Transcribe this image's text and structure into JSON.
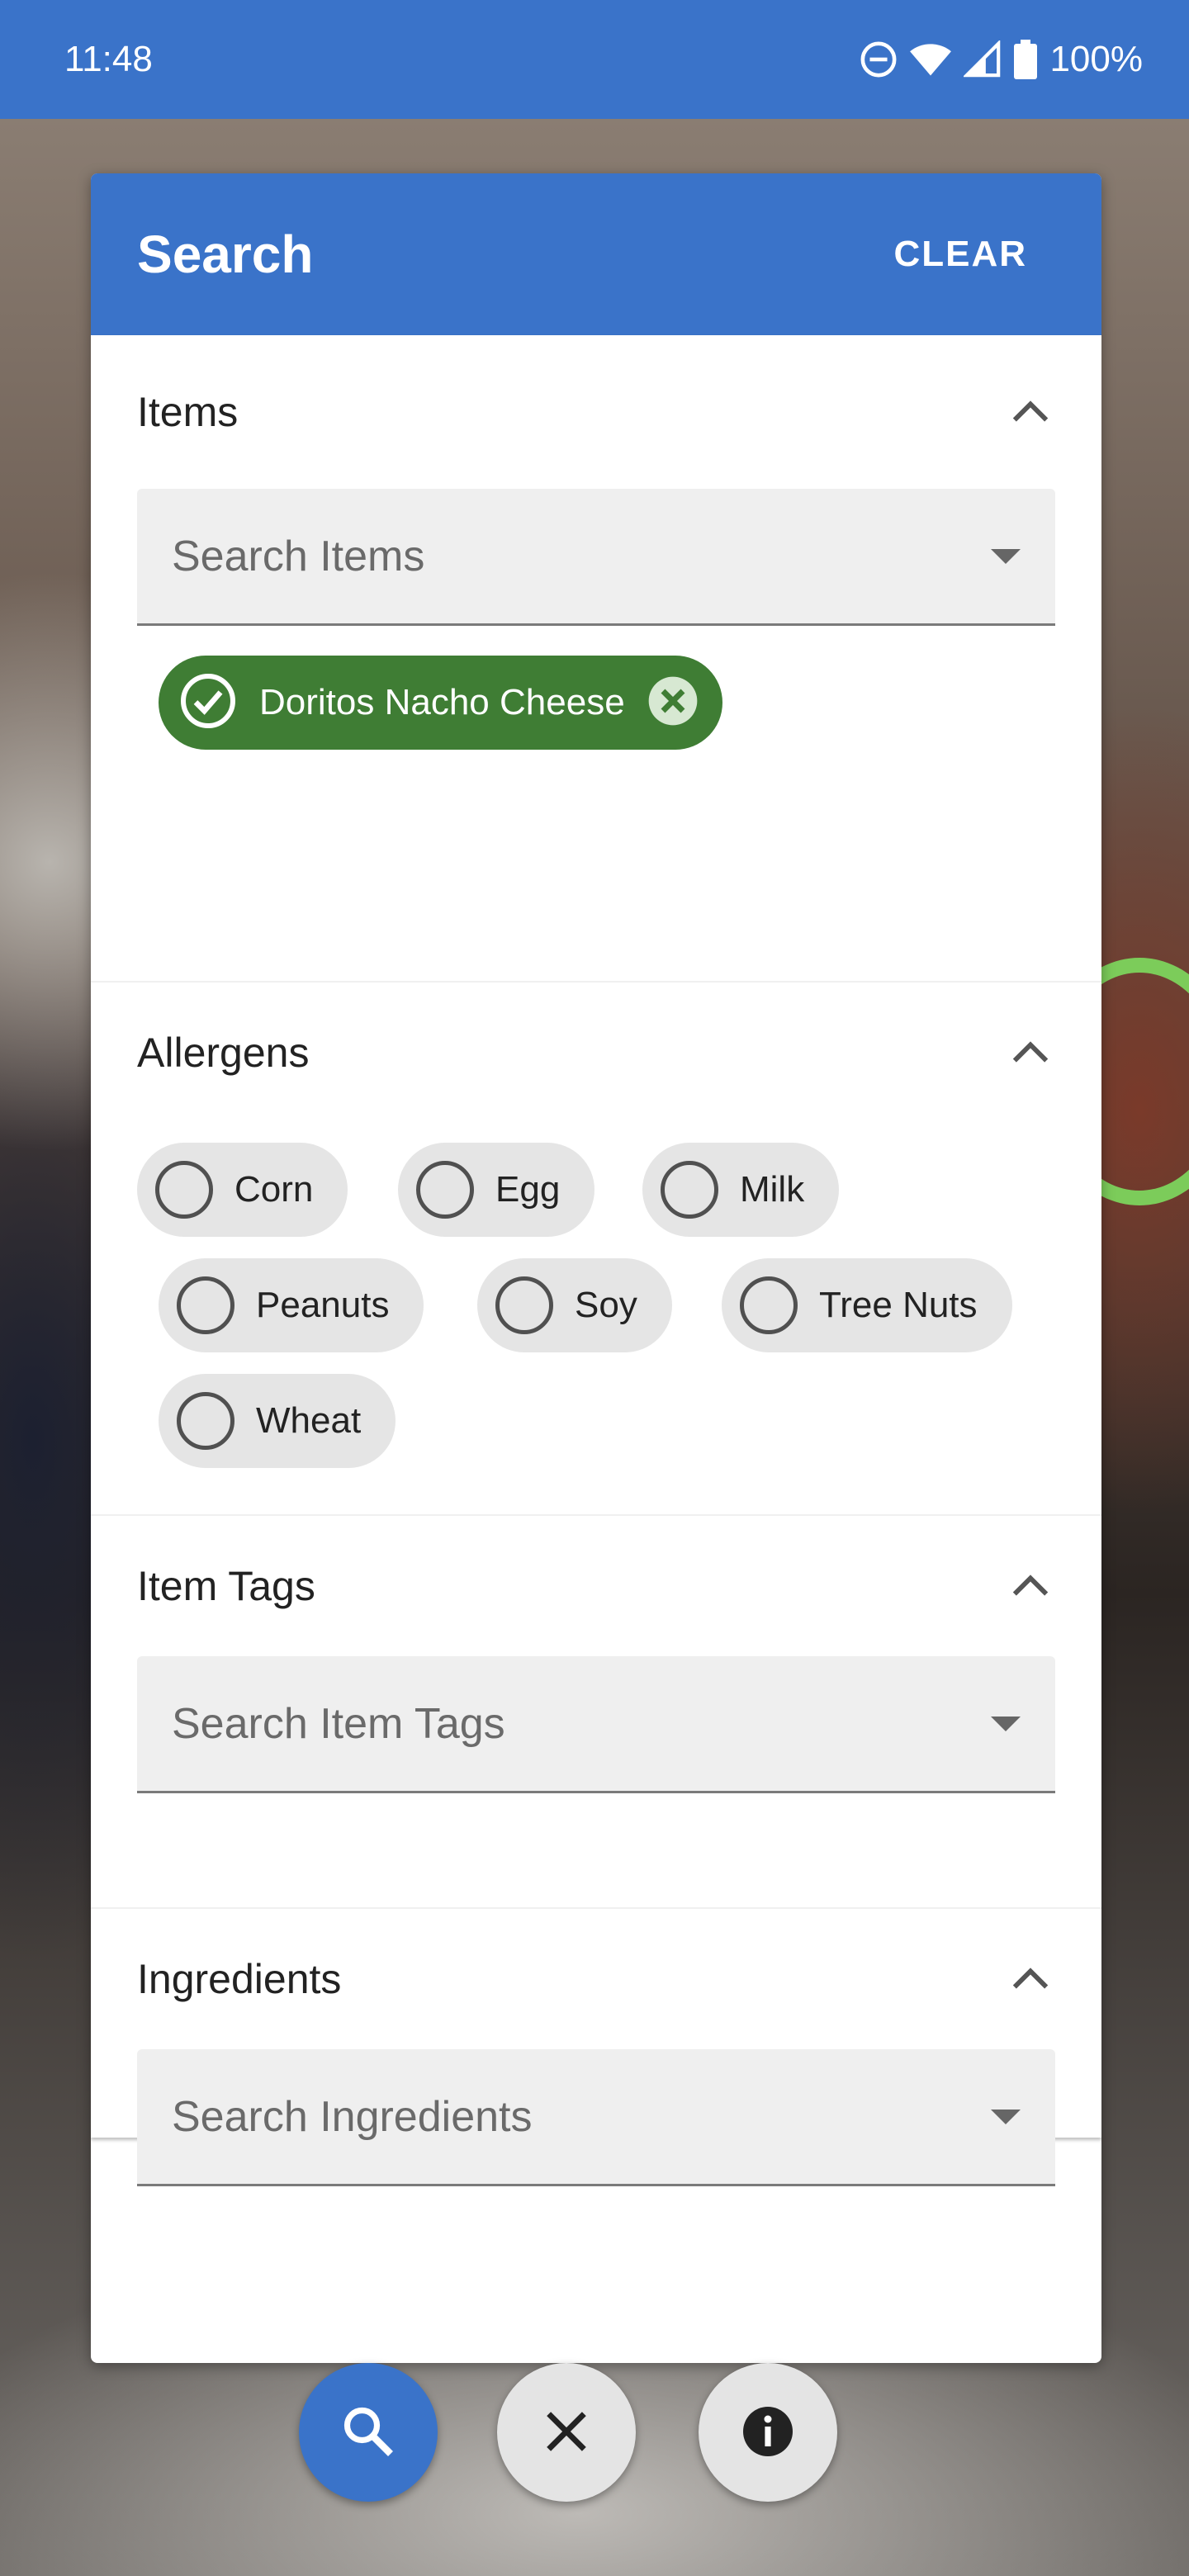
{
  "status_bar": {
    "time": "11:48",
    "battery": "100%",
    "icons": [
      "dnd-icon",
      "wifi-icon",
      "signal-icon",
      "battery-icon"
    ]
  },
  "panel": {
    "title": "Search",
    "clear_label": "CLEAR"
  },
  "sections": {
    "items": {
      "title": "Items",
      "placeholder": "Search Items",
      "selected": [
        "Doritos Nacho Cheese"
      ]
    },
    "allergens": {
      "title": "Allergens",
      "options": [
        "Corn",
        "Egg",
        "Milk",
        "Peanuts",
        "Soy",
        "Tree Nuts",
        "Wheat"
      ]
    },
    "item_tags": {
      "title": "Item Tags",
      "placeholder": "Search Item Tags"
    },
    "ingredients": {
      "title": "Ingredients",
      "placeholder": "Search Ingredients"
    }
  },
  "fabs": [
    "search-icon",
    "close-icon",
    "info-icon"
  ],
  "colors": {
    "primary": "#3a73c9",
    "chip_selected": "#3f7d34",
    "chip_unselected": "#e5e5e5"
  }
}
